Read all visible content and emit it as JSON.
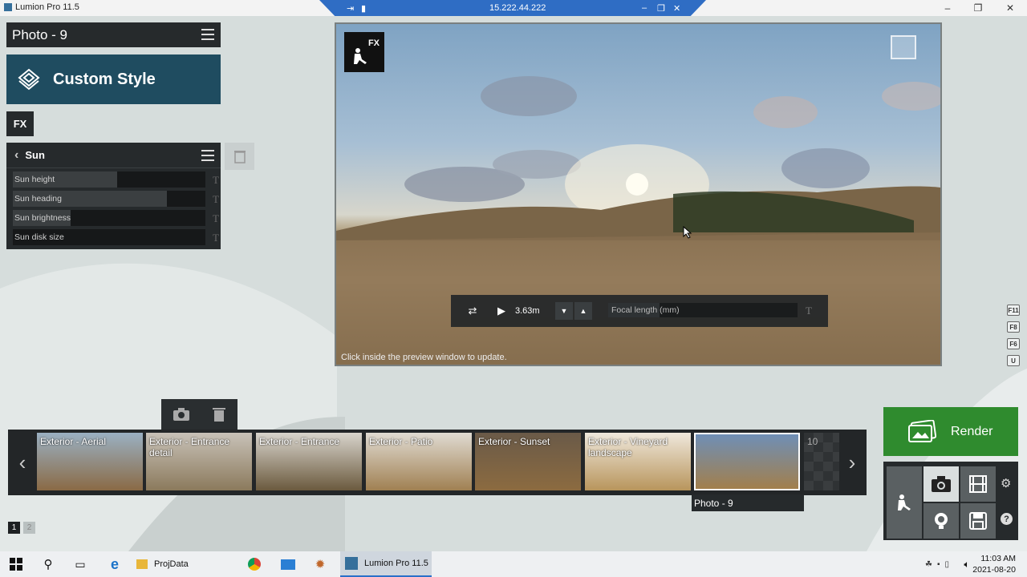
{
  "window": {
    "title": "Lumion Pro 11.5",
    "remote_ip": "15.222.44.222"
  },
  "left_panel": {
    "photo_title": "Photo - 9",
    "style_label": "Custom Style",
    "fx_tab": "FX",
    "effect_title": "Sun",
    "sliders": [
      {
        "label": "Sun height",
        "level": 0.54
      },
      {
        "label": "Sun heading",
        "level": 0.8
      },
      {
        "label": "Sun brightness",
        "level": 0.3
      },
      {
        "label": "Sun disk size",
        "level": 0.0
      }
    ],
    "slider_text_icon": "T"
  },
  "preview": {
    "fx_badge": "FX",
    "camera_height": "3.63m",
    "focal_label": "Focal length (mm)",
    "focal_level": 0.27,
    "focal_text_icon": "T",
    "hint": "Click inside the preview window to update."
  },
  "side_keys": [
    "F11",
    "F8",
    "F6",
    "U"
  ],
  "strip": {
    "thumbnails": [
      {
        "label": "Exterior - Aerial",
        "colors": [
          "#9ab0c2",
          "#8a6a45"
        ]
      },
      {
        "label": "Exterior - Entrance detail",
        "colors": [
          "#c8c2b8",
          "#8b7a5c"
        ]
      },
      {
        "label": "Exterior - Entrance",
        "colors": [
          "#d8d4cc",
          "#6b5a3e"
        ]
      },
      {
        "label": "Exterior - Patio",
        "colors": [
          "#e0dbd2",
          "#a08052"
        ]
      },
      {
        "label": "Exterior - Sunset",
        "colors": [
          "#6a5a48",
          "#8c6b40"
        ]
      },
      {
        "label": "Exterior - Vineyard landscape",
        "colors": [
          "#efe8dc",
          "#b8955c"
        ]
      },
      {
        "label": "",
        "colors": [
          "#6f8fb6",
          "#a27f4c"
        ]
      },
      {
        "label": "10",
        "colors": [
          "#333",
          "#333"
        ]
      }
    ],
    "selected_label": "Photo - 9",
    "pages": [
      "1",
      "2"
    ]
  },
  "render": {
    "label": "Render"
  },
  "taskbar": {
    "folder_label": "ProjData",
    "app_label": "Lumion Pro 11.5",
    "time": "11:03 AM",
    "date": "2021-08-20"
  }
}
